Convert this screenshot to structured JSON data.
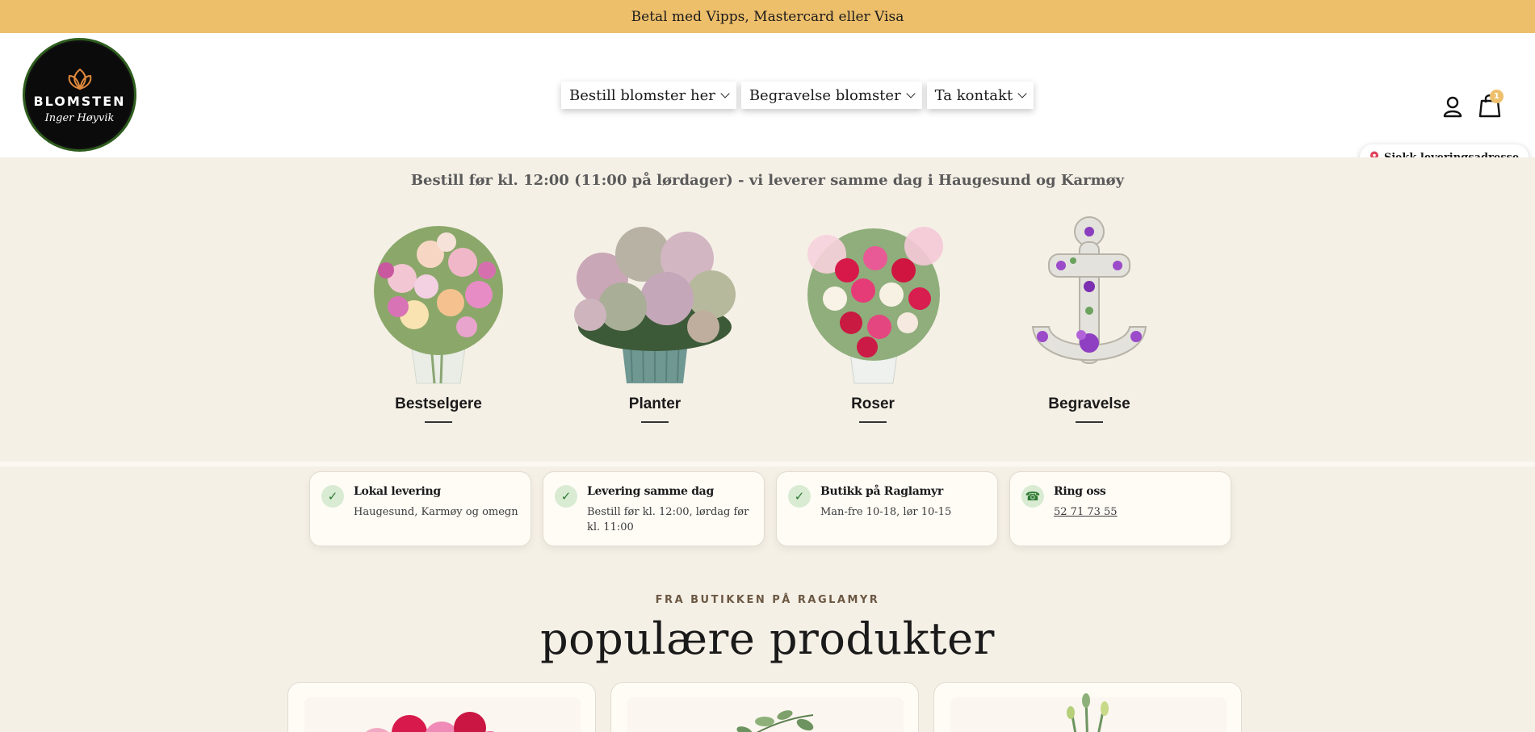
{
  "announcement": "Betal med Vipps, Mastercard eller Visa",
  "logo": {
    "name": "BLOMSTEN",
    "sub": "Inger Høyvik"
  },
  "nav": [
    {
      "label": "Bestill blomster her"
    },
    {
      "label": "Begravelse blomster"
    },
    {
      "label": "Ta kontakt"
    }
  ],
  "cart": {
    "count": "1"
  },
  "delivery_check": "Sjekk leveringsadresse",
  "hero": {
    "notice": "Bestill før kl. 12:00 (11:00 på lørdager) - vi leverer samme dag i Haugesund og Karmøy",
    "categories": [
      {
        "label": "Bestselgere"
      },
      {
        "label": "Planter"
      },
      {
        "label": "Roser"
      },
      {
        "label": "Begravelse"
      }
    ]
  },
  "usps": [
    {
      "icon": "check-icon",
      "title": "Lokal levering",
      "text": "Haugesund, Karmøy og omegn"
    },
    {
      "icon": "check-icon",
      "title": "Levering samme dag",
      "text": "Bestill før kl. 12:00, lørdag før kl. 11:00"
    },
    {
      "icon": "check-icon",
      "title": "Butikk på Raglamyr",
      "text": "Man-fre 10-18, lør 10-15"
    },
    {
      "icon": "phone-icon",
      "title": "Ring oss",
      "text": "52 71 73 55"
    }
  ],
  "products_section": {
    "eyebrow": "FRA BUTIKKEN PÅ RAGLAMYR",
    "title": "populære produkter"
  },
  "colors": {
    "announce": "#eebf6b",
    "hero_bg": "#f5f0e6",
    "accent_green": "#2f7a34"
  }
}
